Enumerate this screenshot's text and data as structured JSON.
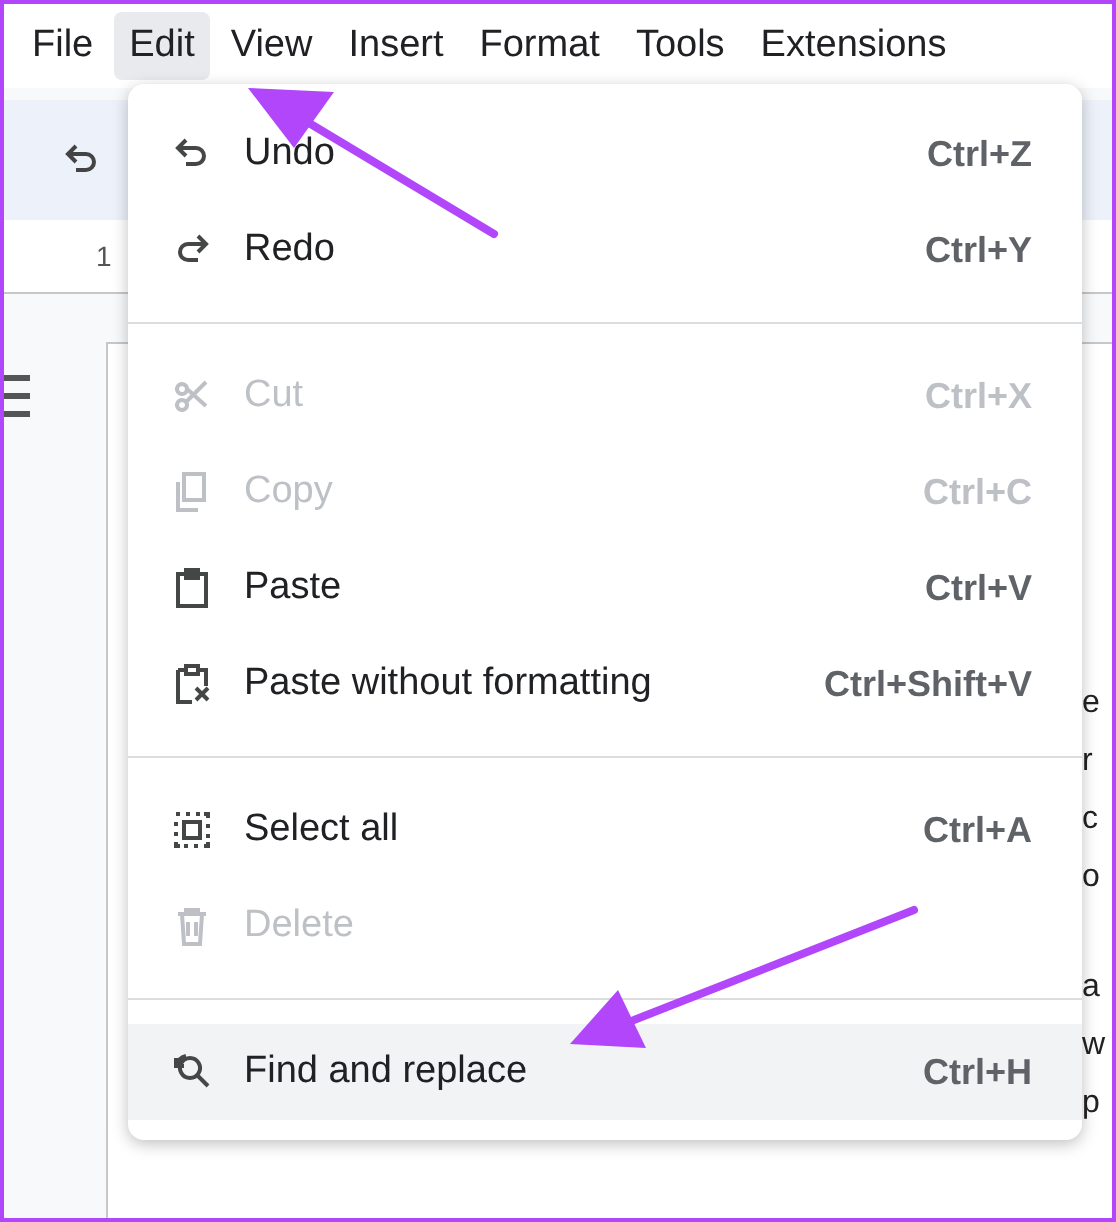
{
  "menu_bar": [
    {
      "label": "File",
      "selected": false
    },
    {
      "label": "Edit",
      "selected": true
    },
    {
      "label": "View",
      "selected": false
    },
    {
      "label": "Insert",
      "selected": false
    },
    {
      "label": "Format",
      "selected": false
    },
    {
      "label": "Tools",
      "selected": false
    },
    {
      "label": "Extensions",
      "selected": false
    }
  ],
  "ruler": {
    "mark": "1"
  },
  "document": {
    "paragraphs": [
      [
        "e",
        "r",
        "c",
        "o"
      ],
      [
        "a",
        "w",
        "p"
      ]
    ]
  },
  "edit_menu": {
    "groups": [
      {
        "items": [
          {
            "label": "Undo",
            "shortcut": "Ctrl+Z",
            "disabled": false,
            "selected": false
          },
          {
            "label": "Redo",
            "shortcut": "Ctrl+Y",
            "disabled": false,
            "selected": false
          }
        ]
      },
      {
        "items": [
          {
            "label": "Cut",
            "shortcut": "Ctrl+X",
            "disabled": true,
            "selected": false
          },
          {
            "label": "Copy",
            "shortcut": "Ctrl+C",
            "disabled": true,
            "selected": false
          },
          {
            "label": "Paste",
            "shortcut": "Ctrl+V",
            "disabled": false,
            "selected": false
          },
          {
            "label": "Paste without formatting",
            "shortcut": "Ctrl+Shift+V",
            "disabled": false,
            "selected": false
          }
        ]
      },
      {
        "items": [
          {
            "label": "Select all",
            "shortcut": "Ctrl+A",
            "disabled": false,
            "selected": false
          },
          {
            "label": "Delete",
            "disabled": true,
            "selected": false
          }
        ]
      },
      {
        "items": [
          {
            "label": "Find and replace",
            "shortcut": "Ctrl+H",
            "disabled": false,
            "selected": true
          }
        ]
      }
    ]
  }
}
